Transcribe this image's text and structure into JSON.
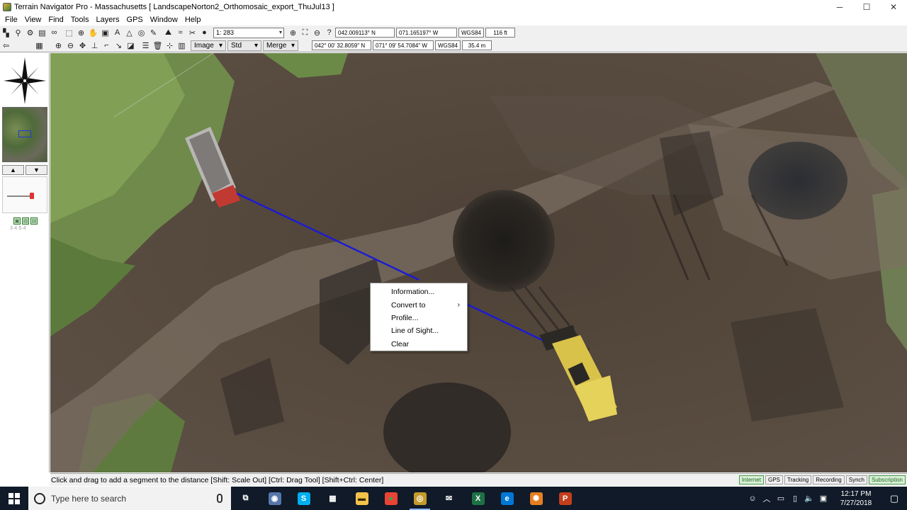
{
  "window": {
    "title": "Terrain Navigator Pro - Massachusetts [ LandscapeNorton2_Orthomosaic_export_ThuJul13 ]",
    "minimize": "─",
    "maximize": "☐",
    "close": "✕"
  },
  "menu": [
    "File",
    "View",
    "Find",
    "Tools",
    "Layers",
    "GPS",
    "Window",
    "Help"
  ],
  "toolbar": {
    "scale_value": "1: 283",
    "lat_decimal": "042.009113° N",
    "lon_decimal": "071.165197° W",
    "datum_1": "WGS84",
    "elevation_ft": "116 ft",
    "lat_dms": "042° 00' 32.8059\" N",
    "lon_dms": "071° 09' 54.7084\" W",
    "datum_2": "WGS84",
    "elevation_m": "35.4 m",
    "image_label": "Image",
    "std_label": "Std",
    "merge_label": "Merge"
  },
  "left_panel": {
    "up": "▲",
    "down": "▼",
    "tiny": "3·4·5·4"
  },
  "context_menu": {
    "items": [
      "Information...",
      "Convert to",
      "Profile...",
      "Line of Sight...",
      "Clear"
    ],
    "submenu_arrow": "›"
  },
  "status": {
    "message": "Click and drag to add a segment to the distance  [Shift: Scale Out] [Ctrl: Drag Tool] [Shift+Ctrl: Center]",
    "panels": [
      {
        "label": "Internet",
        "active": true
      },
      {
        "label": "GPS",
        "active": false
      },
      {
        "label": "Tracking",
        "active": false
      },
      {
        "label": "Recording",
        "active": false
      },
      {
        "label": "Synch",
        "active": false
      },
      {
        "label": "Subscription",
        "active": true
      }
    ]
  },
  "taskbar": {
    "search_placeholder": "Type here to search",
    "apps": [
      {
        "name": "task-view",
        "glyph": "⧉",
        "color": "#ffffff",
        "bg": "transparent"
      },
      {
        "name": "terrain-app",
        "glyph": "◉",
        "color": "#ffffff",
        "bg": "#5577aa"
      },
      {
        "name": "skype",
        "glyph": "S",
        "color": "#ffffff",
        "bg": "#00aff0"
      },
      {
        "name": "calculator",
        "glyph": "▦",
        "color": "#ffffff",
        "bg": "transparent"
      },
      {
        "name": "file-explorer",
        "glyph": "▬",
        "color": "#3a2a00",
        "bg": "#f3c24b"
      },
      {
        "name": "chrome",
        "glyph": "●",
        "color": "#34a853",
        "bg": "#ea4335"
      },
      {
        "name": "terrain-navigator",
        "glyph": "◎",
        "color": "#ffffff",
        "bg": "#c49a2a"
      },
      {
        "name": "mail",
        "glyph": "✉",
        "color": "#ffffff",
        "bg": "transparent"
      },
      {
        "name": "excel",
        "glyph": "X",
        "color": "#ffffff",
        "bg": "#1e7145"
      },
      {
        "name": "edge",
        "glyph": "e",
        "color": "#ffffff",
        "bg": "#0078d7"
      },
      {
        "name": "app-orange",
        "glyph": "✺",
        "color": "#ffffff",
        "bg": "#e67e22"
      },
      {
        "name": "powerpoint",
        "glyph": "P",
        "color": "#ffffff",
        "bg": "#c43e1c"
      }
    ],
    "time": "12:17 PM",
    "date": "7/27/2018"
  }
}
